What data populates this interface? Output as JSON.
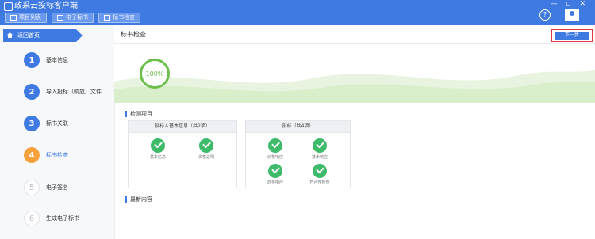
{
  "app": {
    "title": "政采云投标客户端",
    "toolbar_tabs": [
      "项目列表",
      "电子标书",
      "标书检查"
    ],
    "window_controls": "— ▫ ✕"
  },
  "sidebar": {
    "back_label": "返回首页",
    "steps": [
      {
        "num": "1",
        "label": "基本信息",
        "state": "done"
      },
      {
        "num": "2",
        "label": "导入投标（响应）文件",
        "state": "done"
      },
      {
        "num": "3",
        "label": "标书关联",
        "state": "done"
      },
      {
        "num": "4",
        "label": "标书检查",
        "state": "active"
      },
      {
        "num": "5",
        "label": "电子签名",
        "state": "pending"
      },
      {
        "num": "6",
        "label": "生成电子标书",
        "state": "pending"
      }
    ]
  },
  "main": {
    "page_title": "标书检查",
    "next_label": "下一步",
    "progress_text": "100%",
    "progress_value": 100,
    "check_section_title": "检测项目",
    "result_section_title": "最新内容",
    "cards": [
      {
        "title": "投标人基本信息（共2项）",
        "items": [
          "基本信息",
          "资格证明"
        ]
      },
      {
        "title": "投标（共4项）",
        "items": [
          "价格响应",
          "技术响应",
          "商务响应",
          "符合性检查"
        ]
      }
    ]
  },
  "colors": {
    "accent": "#3f7ae2",
    "active_step": "#f6a13b",
    "success": "#3dbb6a",
    "progress_ring": "#6bbf4a",
    "highlight_border": "#e0383e"
  }
}
